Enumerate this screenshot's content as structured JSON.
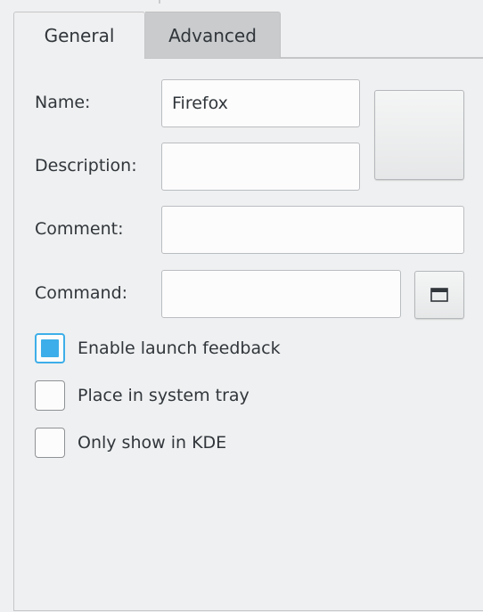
{
  "tabs": [
    {
      "label": "General",
      "active": true
    },
    {
      "label": "Advanced",
      "active": false
    }
  ],
  "form": {
    "name_label": "Name:",
    "name_value": "Firefox",
    "description_label": "Description:",
    "description_value": "",
    "comment_label": "Comment:",
    "comment_value": "",
    "command_label": "Command:",
    "command_value": ""
  },
  "icons": {
    "app_icon": "app-icon-button",
    "browse": "folder-icon"
  },
  "options": [
    {
      "label": "Enable launch feedback",
      "checked": true
    },
    {
      "label": "Place in system tray",
      "checked": false
    },
    {
      "label": "Only show in KDE",
      "checked": false
    }
  ],
  "colors": {
    "accent": "#3daee9",
    "window": "#eff0f1",
    "inactive_tab": "#c9cbcd"
  }
}
